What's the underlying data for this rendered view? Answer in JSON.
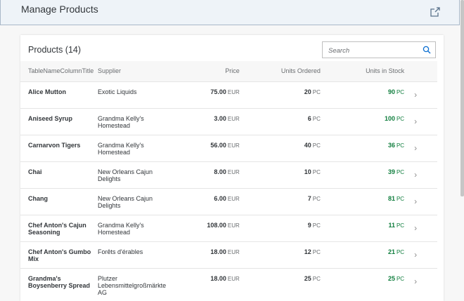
{
  "header": {
    "title": "Manage Products",
    "share_icon": "share-icon"
  },
  "table": {
    "title": "Products (14)",
    "search_placeholder": "Search",
    "columns": [
      "TableNameColumnTitle",
      "Supplier",
      "Price",
      "Units Ordered",
      "Units in Stock"
    ],
    "rows": [
      {
        "name": "Alice Mutton",
        "supplier": "Exotic Liquids",
        "price": "75.00",
        "currency": "EUR",
        "ordered": "20",
        "ordered_unit": "PC",
        "stock": "90",
        "stock_unit": "PC"
      },
      {
        "name": "Aniseed Syrup",
        "supplier": "Grandma Kelly's Homestead",
        "price": "3.00",
        "currency": "EUR",
        "ordered": "6",
        "ordered_unit": "PC",
        "stock": "100",
        "stock_unit": "PC"
      },
      {
        "name": "Carnarvon Tigers",
        "supplier": "Grandma Kelly's Homestead",
        "price": "56.00",
        "currency": "EUR",
        "ordered": "40",
        "ordered_unit": "PC",
        "stock": "36",
        "stock_unit": "PC"
      },
      {
        "name": "Chai",
        "supplier": "New Orleans Cajun Delights",
        "price": "8.00",
        "currency": "EUR",
        "ordered": "10",
        "ordered_unit": "PC",
        "stock": "39",
        "stock_unit": "PC"
      },
      {
        "name": "Chang",
        "supplier": "New Orleans Cajun Delights",
        "price": "6.00",
        "currency": "EUR",
        "ordered": "7",
        "ordered_unit": "PC",
        "stock": "81",
        "stock_unit": "PC"
      },
      {
        "name": "Chef Anton's Cajun Seasoning",
        "supplier": "Grandma Kelly's Homestead",
        "price": "108.00",
        "currency": "EUR",
        "ordered": "9",
        "ordered_unit": "PC",
        "stock": "11",
        "stock_unit": "PC"
      },
      {
        "name": "Chef Anton's Gumbo Mix",
        "supplier": "Forêts d'érables",
        "price": "18.00",
        "currency": "EUR",
        "ordered": "12",
        "ordered_unit": "PC",
        "stock": "21",
        "stock_unit": "PC"
      },
      {
        "name": "Grandma's Boysenberry Spread",
        "supplier": "Plutzer Lebensmittelgroßmärkte AG",
        "price": "18.00",
        "currency": "EUR",
        "ordered": "25",
        "ordered_unit": "PC",
        "stock": "25",
        "stock_unit": "PC"
      }
    ]
  },
  "colors": {
    "stock_positive": "#107e3e",
    "header_bg": "#eef3f8"
  }
}
